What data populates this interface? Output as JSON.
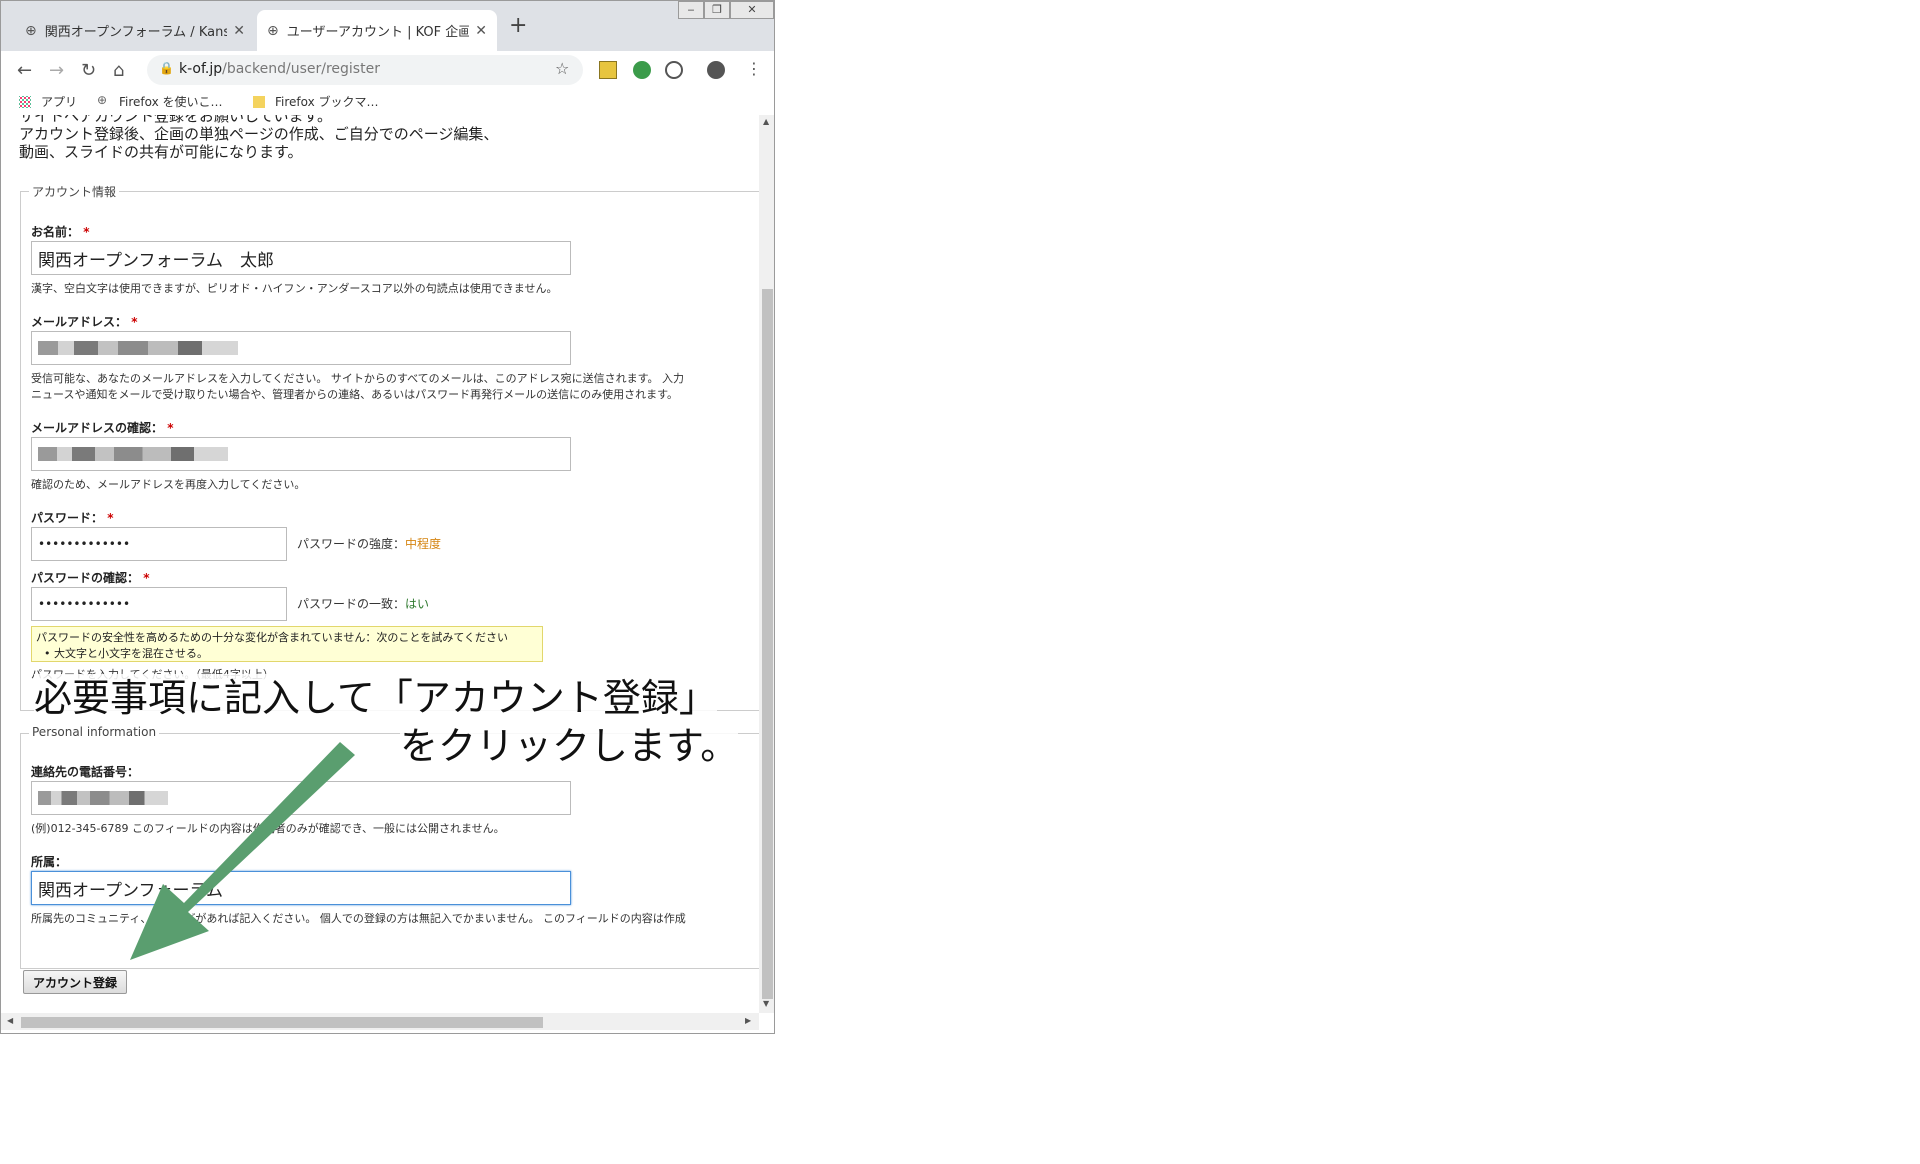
{
  "browser": {
    "tabs": [
      {
        "title": "関西オープンフォーラム / Kans"
      },
      {
        "title": "ユーザーアカウント | KOF 企画"
      }
    ],
    "new_tab": "+",
    "url_host": "k-of.jp",
    "url_path": "/backend/user/register",
    "window_buttons": [
      "‒",
      "❐",
      "✕"
    ],
    "bookmarks": [
      {
        "label": "アプリ"
      },
      {
        "label": "Firefox を使いこ…"
      },
      {
        "label": "Firefox ブックマ…"
      }
    ]
  },
  "page": {
    "intro_lines": [
      "サイトへアカウント登録をお願いしています。",
      "アカウント登録後、企画の単独ページの作成、ご自分でのページ編集、",
      "動画、スライドの共有が可能になります。"
    ],
    "account_section": {
      "legend": "アカウント情報",
      "name_label": "お名前：",
      "name_value": "関西オープンフォーラム　太郎",
      "name_desc": "漢字、空白文字は使用できますが、ピリオド・ハイフン・アンダースコア以外の句読点は使用できません。",
      "email_label": "メールアドレス：",
      "email_desc_1": "受信可能な、あなたのメールアドレスを入力してください。 サイトからのすべてのメールは、このアドレス宛に送信されます。 入力",
      "email_desc_2": "ニュースや通知をメールで受け取りたい場合や、管理者からの連絡、あるいはパスワード再発行メールの送信にのみ使用されます。",
      "email_confirm_label": "メールアドレスの確認：",
      "email_confirm_desc": "確認のため、メールアドレスを再度入力してください。",
      "password_label": "パスワード：",
      "password_value": "•••••••••••••",
      "strength_label": "パスワードの強度：",
      "strength_value": "中程度",
      "password_confirm_label": "パスワードの確認：",
      "password_confirm_value": "•••••••••••••",
      "match_label": "パスワードの一致：",
      "match_value": "はい",
      "warning_title": "パスワードの安全性を高めるための十分な変化が含まれていません：次のことを試みてください",
      "warning_item": "大文字と小文字を混在させる。",
      "password_desc": "パスワードを入力してください。（最低4字以上）",
      "required_mark": "*"
    },
    "personal_section": {
      "legend": "Personal information",
      "phone_label": "連絡先の電話番号：",
      "phone_desc": "(例)012-345-6789 このフィールドの内容は作成者のみが確認でき、一般には公開されません。",
      "affiliation_label": "所属：",
      "affiliation_value": "関西オープンフォーラム",
      "affiliation_desc": "所属先のコミュニティ、企業などがあれば記入ください。 個人での登録の方は無記入でかまいません。 このフィールドの内容は作成"
    },
    "submit_label": "アカウント登録"
  },
  "annotation": {
    "line1": "必要事項に記入して「アカウント登録」",
    "line2": "をクリックします。",
    "arrow_color": "#5a9e6f"
  }
}
